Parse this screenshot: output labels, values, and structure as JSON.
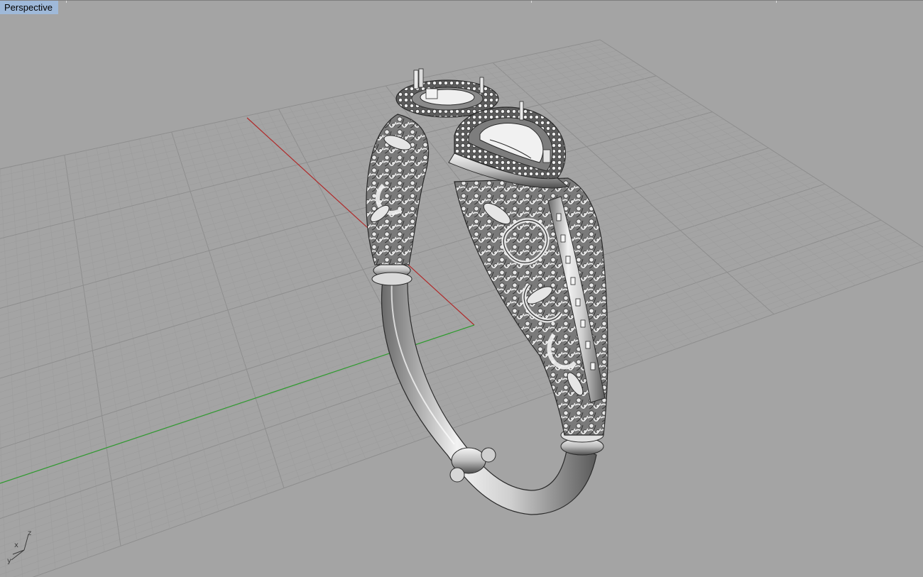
{
  "viewport": {
    "title": "Perspective",
    "background": "#a4a4a4",
    "grid_minor_color": "#9d9d9d",
    "grid_major_color": "#8e8e8e",
    "x_axis_color": "#b02a2a",
    "y_axis_color": "#2f9a2f",
    "title_bg": "#9fb9d9"
  },
  "axis_gizmo": {
    "x_label": "x",
    "y_label": "y",
    "z_label": "z"
  },
  "model": {
    "object": "ring",
    "shaded": true
  }
}
